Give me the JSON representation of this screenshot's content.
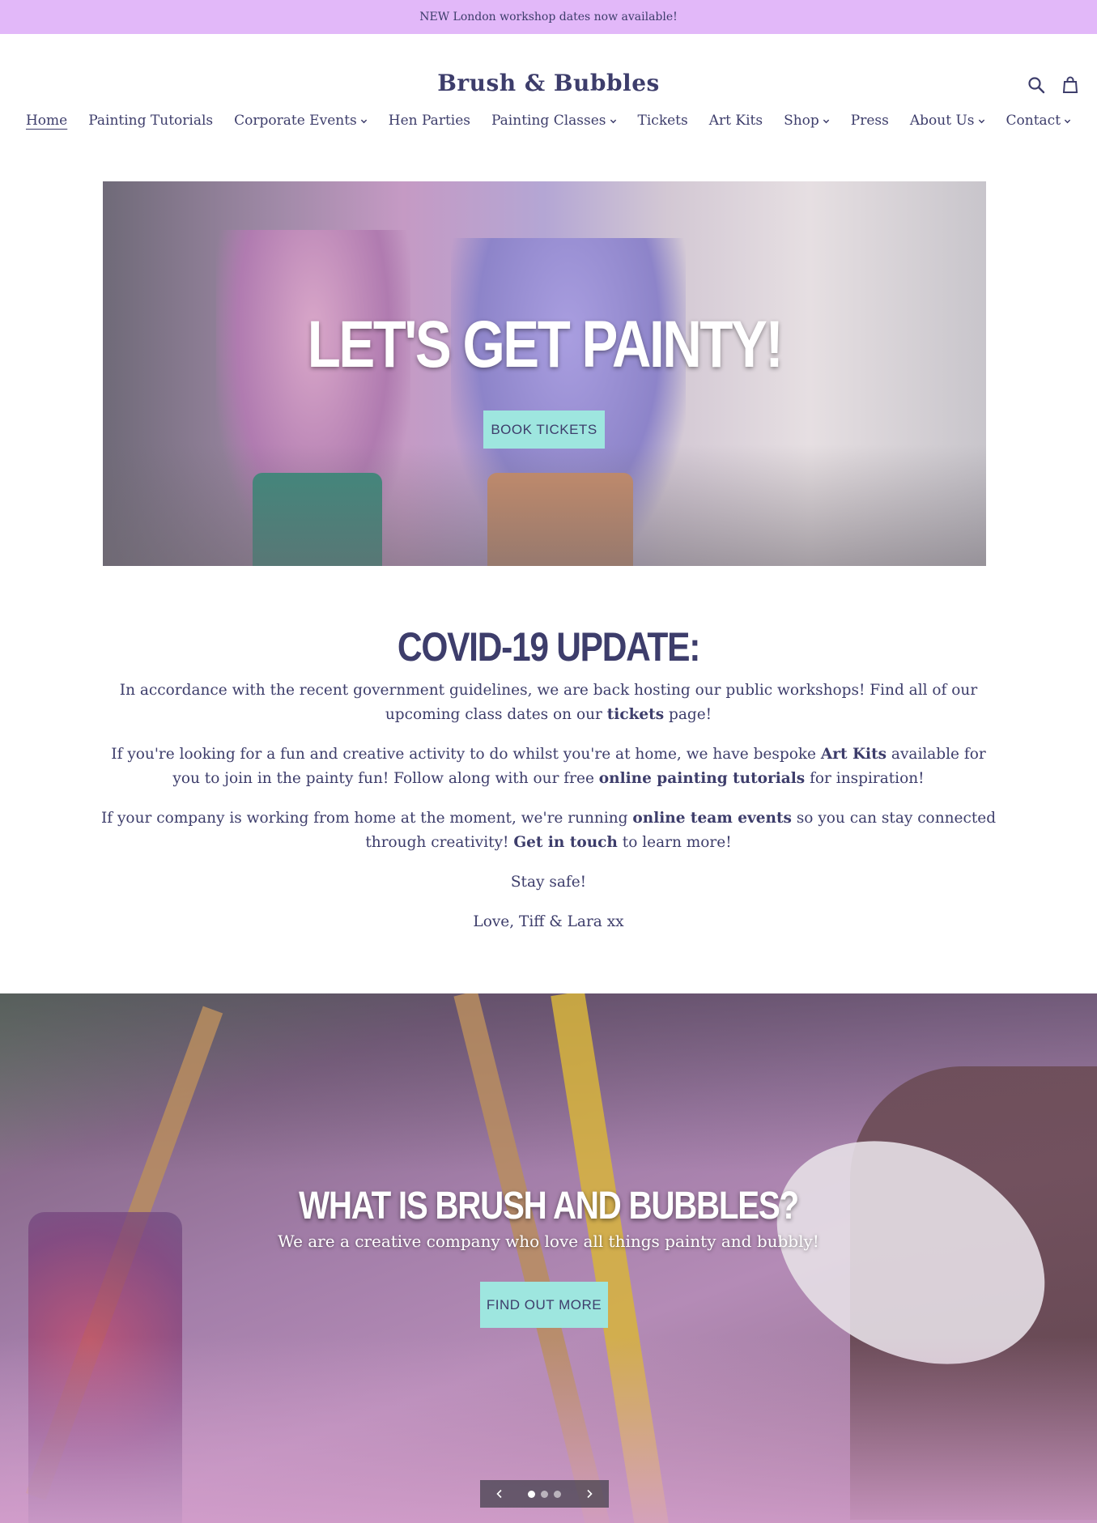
{
  "announcement": "NEW London workshop dates now available!",
  "brand": {
    "logo_text": "Brush & Bubbles"
  },
  "header": {
    "icons": [
      "search-icon",
      "cart-icon"
    ]
  },
  "nav": {
    "items": [
      {
        "label": "Home",
        "dropdown": false,
        "active": true
      },
      {
        "label": "Painting Tutorials",
        "dropdown": false
      },
      {
        "label": "Corporate Events",
        "dropdown": true
      },
      {
        "label": "Hen Parties",
        "dropdown": false
      },
      {
        "label": "Painting Classes",
        "dropdown": true
      },
      {
        "label": "Tickets",
        "dropdown": false
      },
      {
        "label": "Art Kits",
        "dropdown": false
      },
      {
        "label": "Shop",
        "dropdown": true
      },
      {
        "label": "Press",
        "dropdown": false
      },
      {
        "label": "About Us",
        "dropdown": true
      },
      {
        "label": "Contact",
        "dropdown": true
      }
    ]
  },
  "hero": {
    "title": "LET'S GET PAINTY!",
    "button_label": "BOOK TICKETS"
  },
  "covid": {
    "title": "COVID-19 UPDATE:",
    "p1_a": "In accordance with the recent government guidelines, we are back hosting our public workshops! Find all of our upcoming class dates on our ",
    "p1_link": "tickets",
    "p1_b": " page!",
    "p2_a": "If you're looking for a fun and creative activity to do whilst you're at home, we have bespoke ",
    "p2_link1": "Art Kits",
    "p2_b": " available for you to join in the painty fun! Follow along with our free ",
    "p2_link2": "online painting tutorials",
    "p2_c": " for inspiration!",
    "p3_a": "If your company is working from home at the moment, we're running ",
    "p3_link1": "online team events",
    "p3_b": " so you can stay connected through creativity! ",
    "p3_link2": "Get in touch",
    "p3_c": " to learn more!",
    "p4": "Stay safe!",
    "p5": "Love, Tiff & Lara xx"
  },
  "slideshow": {
    "title": "WHAT IS BRUSH AND BUBBLES?",
    "subtitle": "We are a creative company who love all things painty and bubbly!",
    "button_label": "FIND OUT MORE",
    "slide_count": 3,
    "active_slide": 1
  },
  "colors": {
    "announcement_bg": "#e2b8f9",
    "brand_text": "#3d3d6b",
    "button_bg": "#9ee6df"
  }
}
